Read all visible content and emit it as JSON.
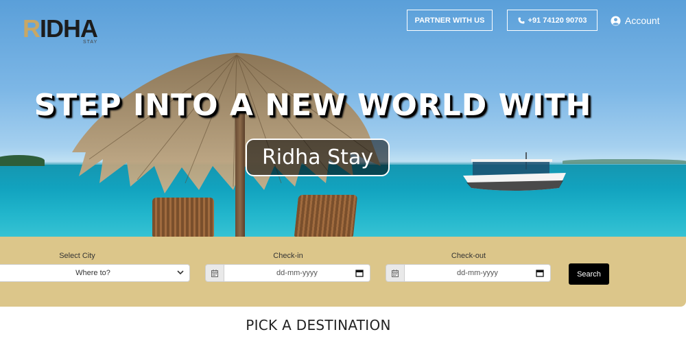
{
  "brand": {
    "logo_r": "R",
    "logo_idha": "IDHA",
    "logo_sub": "STAY"
  },
  "header": {
    "partner_label": "PARTNER WITH US",
    "phone_label": "+91 74120 90703",
    "account_label": "Account"
  },
  "hero": {
    "headline": "STEP INTO A NEW WORLD WITH",
    "brand_name": "Ridha Stay"
  },
  "search": {
    "city_label": "Select City",
    "city_value": "Where to?",
    "checkin_label": "Check-in",
    "checkin_placeholder": "dd-mm-yyyy",
    "checkout_label": "Check-out",
    "checkout_placeholder": "dd-mm-yyyy",
    "button_label": "Search"
  },
  "section": {
    "title": "PICK A DESTINATION"
  },
  "colors": {
    "accent": "#dcc68a",
    "logo_gold": "#c8a765",
    "button": "#000000"
  },
  "icons": [
    "phone-icon",
    "account-icon",
    "calendar-icon",
    "chevron-down-icon"
  ]
}
